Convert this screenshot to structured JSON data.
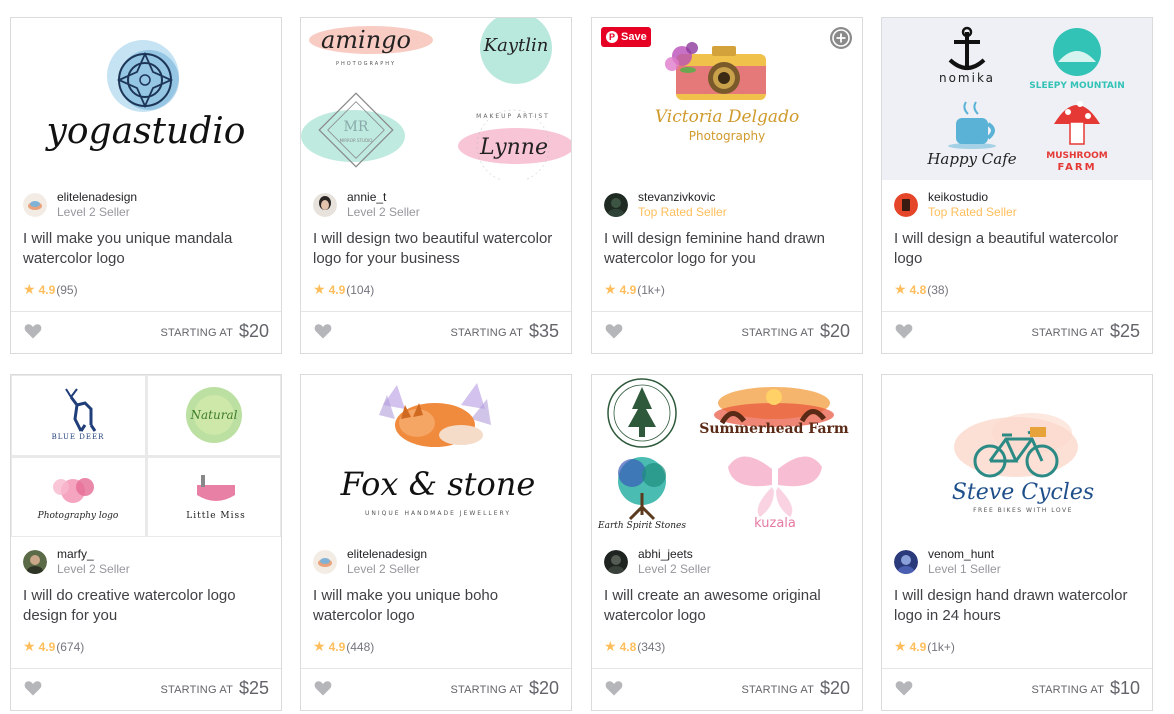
{
  "gigs": [
    {
      "seller": {
        "name": "elitelenadesign",
        "level": "Level 2 Seller"
      },
      "title": "I will make you unique mandala watercolor logo",
      "rating": {
        "score": "4.9",
        "count": "(95)"
      },
      "price": {
        "label": "STARTING AT",
        "value": "$20"
      },
      "image": {
        "text": "yogastudio"
      }
    },
    {
      "seller": {
        "name": "annie_t",
        "level": "Level 2 Seller"
      },
      "title": "I will design two beautiful watercolor logo for your business",
      "rating": {
        "score": "4.9",
        "count": "(104)"
      },
      "price": {
        "label": "STARTING AT",
        "value": "$35"
      },
      "image": {
        "text1": "amingo",
        "text1_sub": "PHOTOGRAPHY",
        "text2": "Kaytlin",
        "text3": "MR",
        "text3_sub": "MIRROR STUDIO",
        "text4": "Lynne",
        "text4_sub": "MAKEUP ARTIST"
      }
    },
    {
      "seller": {
        "name": "stevanzivkovic",
        "level": "Top Rated Seller"
      },
      "title": "I will design feminine hand drawn watercolor logo for you",
      "rating": {
        "score": "4.9",
        "count": "(1k+)"
      },
      "price": {
        "label": "STARTING AT",
        "value": "$20"
      },
      "image": {
        "save": "Save",
        "text1": "Victoria Delgado",
        "text2": "Photography"
      }
    },
    {
      "seller": {
        "name": "keikostudio",
        "level": "Top Rated Seller"
      },
      "title": "I will design a beautiful watercolor logo",
      "rating": {
        "score": "4.8",
        "count": "(38)"
      },
      "price": {
        "label": "STARTING AT",
        "value": "$25"
      },
      "image": {
        "text1": "nomika",
        "text2": "SLEEPY MOUNTAIN",
        "text3": "Happy Cafe",
        "text4": "MUSHROOM",
        "text5": "FARM"
      }
    },
    {
      "seller": {
        "name": "marfy_",
        "level": "Level 2 Seller"
      },
      "title": "I will do creative watercolor logo design for you",
      "rating": {
        "score": "4.9",
        "count": "(674)"
      },
      "price": {
        "label": "STARTING AT",
        "value": "$25"
      },
      "image": {
        "text1": "BLUE DEER",
        "text2": "Natural",
        "text3": "Photography logo",
        "text4": "Little Miss"
      }
    },
    {
      "seller": {
        "name": "elitelenadesign",
        "level": "Level 2 Seller"
      },
      "title": "I will make you unique boho watercolor logo",
      "rating": {
        "score": "4.9",
        "count": "(448)"
      },
      "price": {
        "label": "STARTING AT",
        "value": "$20"
      },
      "image": {
        "text1": "Fox & stone",
        "text2": "UNIQUE HANDMADE JEWELLERY"
      }
    },
    {
      "seller": {
        "name": "abhi_jeets",
        "level": "Level 2 Seller"
      },
      "title": "I will create an awesome original watercolor logo",
      "rating": {
        "score": "4.8",
        "count": "(343)"
      },
      "price": {
        "label": "STARTING AT",
        "value": "$20"
      },
      "image": {
        "text1": "Summerhead Farm",
        "text2": "Earth Spirit Stones",
        "text3": "kuzala"
      }
    },
    {
      "seller": {
        "name": "venom_hunt",
        "level": "Level 1 Seller"
      },
      "title": "I will design hand drawn watercolor logo in 24 hours",
      "rating": {
        "score": "4.9",
        "count": "(1k+)"
      },
      "price": {
        "label": "STARTING AT",
        "value": "$10"
      },
      "image": {
        "text1": "Steve Cycles",
        "text2": "FREE BIKES WITH LOVE"
      }
    }
  ],
  "icons": {
    "star": "star-icon",
    "heart": "heart-icon",
    "pinterest": "pinterest-icon",
    "plus": "plus-circle-icon"
  },
  "colors": {
    "top_rated": "#ffbe5b",
    "star": "#ffbe5b",
    "pinterest": "#e60023",
    "price": "#62646a"
  }
}
